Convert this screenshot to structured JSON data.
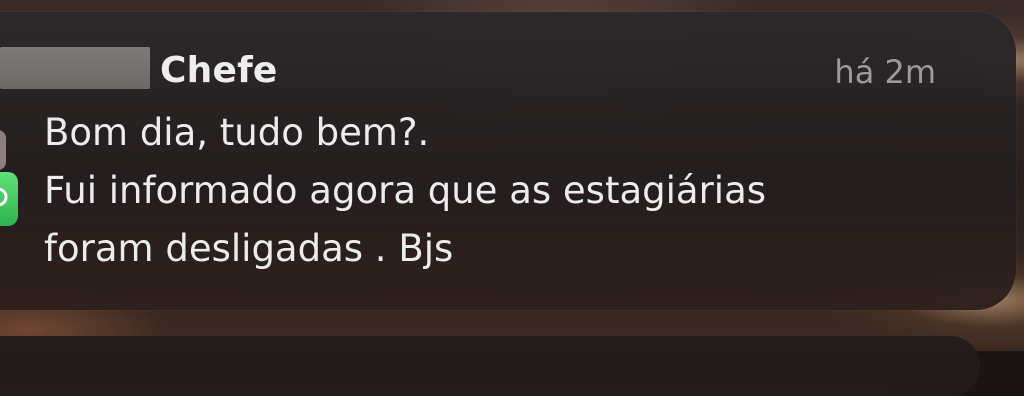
{
  "notification": {
    "sender": "Chefe",
    "time": "há 2m",
    "message_lines": [
      "Bom dia, tudo bem?.",
      "Fui informado agora que as estagiárias",
      "foram desligadas . Bjs"
    ],
    "app_icon": "whatsapp-icon",
    "sender_prefix_redacted": true
  },
  "colors": {
    "card_background": "#2a2526",
    "text_primary": "#ececec",
    "text_secondary": "#9e9a98",
    "app_icon_green": "#3dc45b"
  }
}
